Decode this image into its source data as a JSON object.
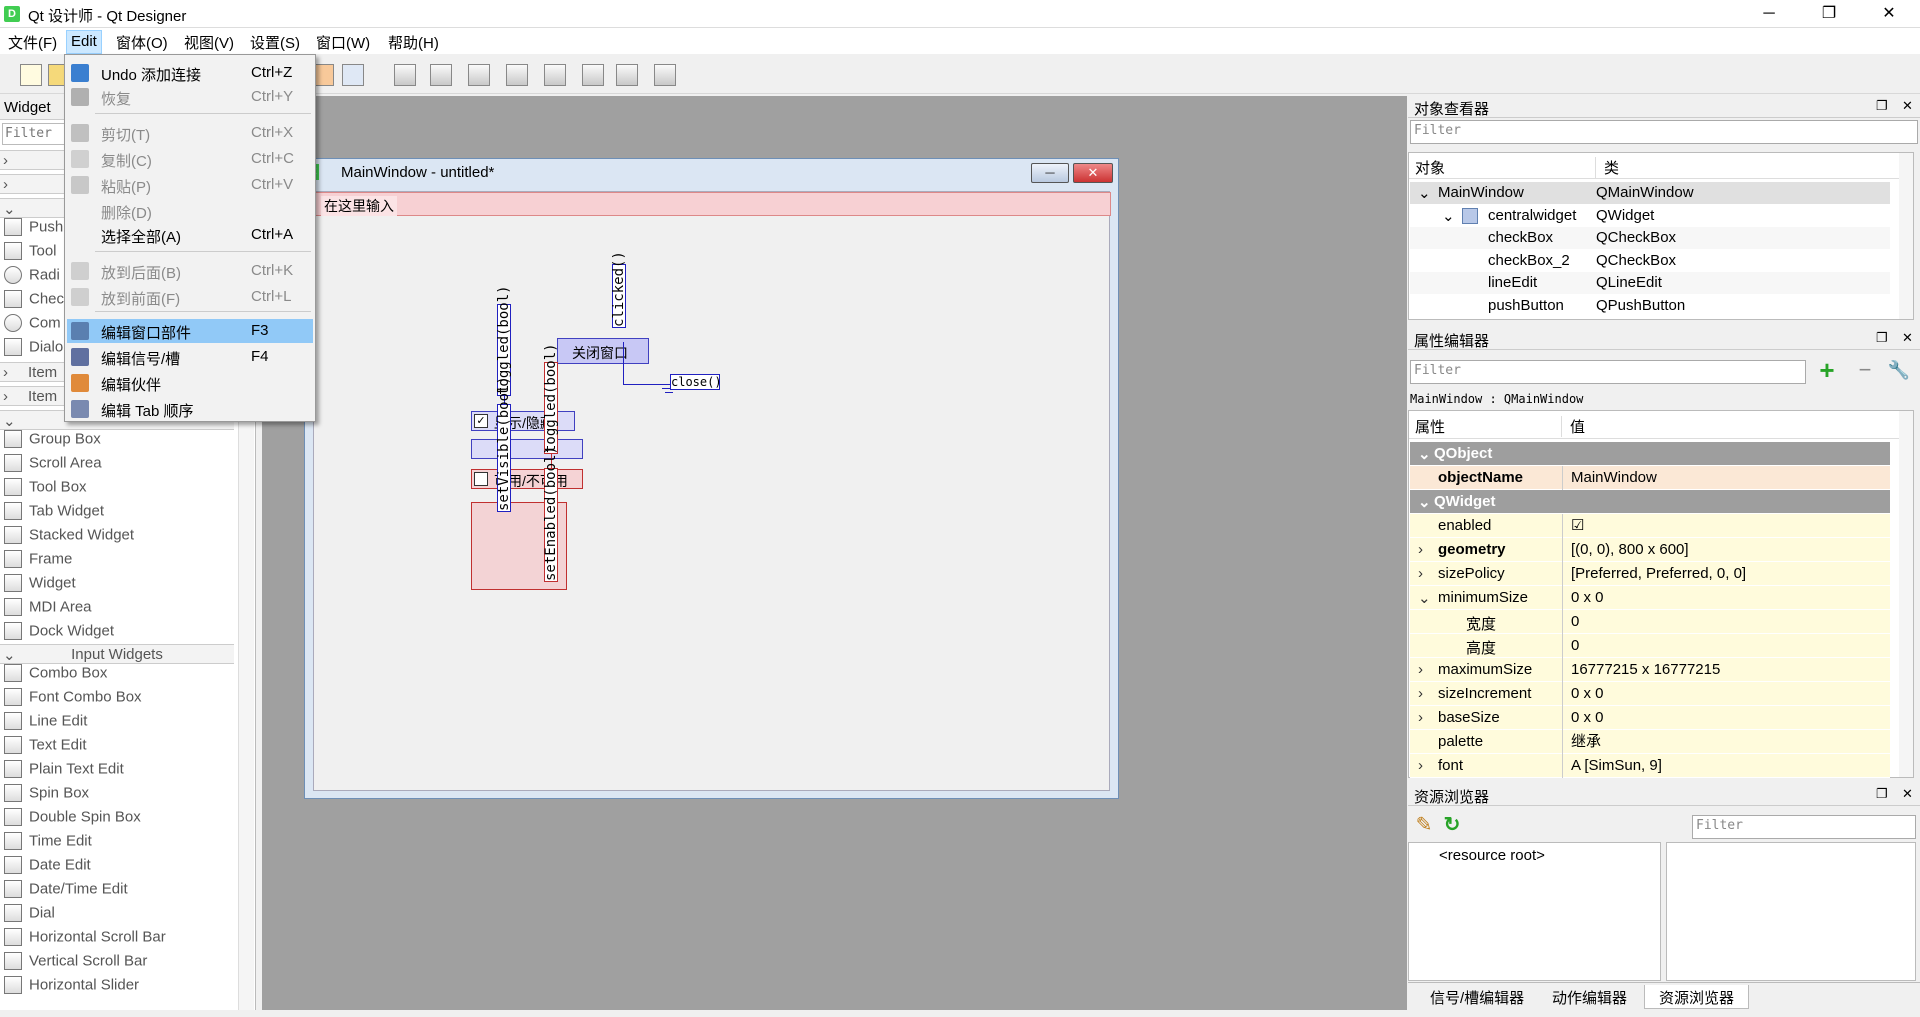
{
  "window": {
    "title": "Qt 设计师 - Qt Designer",
    "app_icon": "D",
    "minimize": "─",
    "maximize": "❐",
    "close": "✕"
  },
  "menubar": [
    "文件(F)",
    "Edit",
    "窗体(O)",
    "视图(V)",
    "设置(S)",
    "窗口(W)",
    "帮助(H)"
  ],
  "edit_menu": [
    {
      "label": "Undo 添加连接",
      "shortcut": "Ctrl+Z",
      "disabled": false,
      "icon": "undo-icon"
    },
    {
      "label": "恢复",
      "shortcut": "Ctrl+Y",
      "disabled": true,
      "icon": "redo-icon"
    },
    {
      "label": "剪切(T)",
      "shortcut": "Ctrl+X",
      "disabled": true,
      "icon": "scissors-icon"
    },
    {
      "label": "复制(C)",
      "shortcut": "Ctrl+C",
      "disabled": true,
      "icon": "copy-icon"
    },
    {
      "label": "粘贴(P)",
      "shortcut": "Ctrl+V",
      "disabled": true,
      "icon": "paste-icon"
    },
    {
      "label": "删除(D)",
      "shortcut": "",
      "disabled": true,
      "icon": ""
    },
    {
      "label": "选择全部(A)",
      "shortcut": "Ctrl+A",
      "disabled": false,
      "icon": ""
    },
    {
      "label": "放到后面(B)",
      "shortcut": "Ctrl+K",
      "disabled": true,
      "icon": "send-back-icon"
    },
    {
      "label": "放到前面(F)",
      "shortcut": "Ctrl+L",
      "disabled": true,
      "icon": "bring-front-icon"
    },
    {
      "label": "编辑窗口部件",
      "shortcut": "F3",
      "disabled": false,
      "icon": "edit-widgets-icon",
      "highlighted": true
    },
    {
      "label": "编辑信号/槽",
      "shortcut": "F4",
      "disabled": false,
      "icon": "edit-signals-icon"
    },
    {
      "label": "编辑伙伴",
      "shortcut": "",
      "disabled": false,
      "icon": "edit-buddies-icon"
    },
    {
      "label": "编辑 Tab 顺序",
      "shortcut": "",
      "disabled": false,
      "icon": "edit-tab-order-icon"
    }
  ],
  "widget_box": {
    "title": "Widget",
    "filter_placeholder": "Filter",
    "partial_items": [
      "Push",
      "Tool",
      "Radi",
      "Chec",
      "Com",
      "Dialo"
    ],
    "partial_cats": [
      "Item",
      "Item"
    ],
    "containers": [
      "Group Box",
      "Scroll Area",
      "Tool Box",
      "Tab Widget",
      "Stacked Widget",
      "Frame",
      "Widget",
      "MDI Area",
      "Dock Widget"
    ],
    "input_cat": "Input Widgets",
    "inputs": [
      "Combo Box",
      "Font Combo Box",
      "Line Edit",
      "Text Edit",
      "Plain Text Edit",
      "Spin Box",
      "Double Spin Box",
      "Time Edit",
      "Date Edit",
      "Date/Time Edit",
      "Dial",
      "Horizontal Scroll Bar",
      "Vertical Scroll Bar",
      "Horizontal Slider"
    ]
  },
  "form": {
    "title": "MainWindow - untitled*",
    "menu_placeholder": "在这里输入",
    "button_text": "关闭窗口",
    "checkbox1": "显示/隐藏",
    "checkbox2": "可用/不可用",
    "signal_clicked": "clicked()",
    "slot_close": "close()",
    "signal_toggled1": "toggled(bool)",
    "slot_setvisible": "setVisible(bool)",
    "signal_toggled2": "toggled(bool)",
    "slot_setenabled": "setEnabled(bool)"
  },
  "object_inspector": {
    "title": "对象查看器",
    "filter_placeholder": "Filter",
    "col_object": "对象",
    "col_class": "类",
    "rows": [
      {
        "name": "MainWindow",
        "cls": "QMainWindow"
      },
      {
        "name": "centralwidget",
        "cls": "QWidget"
      },
      {
        "name": "checkBox",
        "cls": "QCheckBox"
      },
      {
        "name": "checkBox_2",
        "cls": "QCheckBox"
      },
      {
        "name": "lineEdit",
        "cls": "QLineEdit"
      },
      {
        "name": "pushButton",
        "cls": "QPushButton"
      }
    ]
  },
  "property_editor": {
    "title": "属性编辑器",
    "filter_placeholder": "Filter",
    "context": "MainWindow : QMainWindow",
    "col_prop": "属性",
    "col_value": "值",
    "rows": [
      {
        "name": "QObject",
        "value": "",
        "kind": "group"
      },
      {
        "name": "objectName",
        "value": "MainWindow",
        "kind": "obj"
      },
      {
        "name": "QWidget",
        "value": "",
        "kind": "group"
      },
      {
        "name": "enabled",
        "value": "☑",
        "kind": "yellow"
      },
      {
        "name": "geometry",
        "value": "[(0, 0), 800 x 600]",
        "kind": "yellow",
        "bold": true
      },
      {
        "name": "sizePolicy",
        "value": "[Preferred, Preferred, 0, 0]",
        "kind": "yellow"
      },
      {
        "name": "minimumSize",
        "value": "0 x 0",
        "kind": "yellow"
      },
      {
        "name": "宽度",
        "value": "0",
        "kind": "yellow-sub"
      },
      {
        "name": "高度",
        "value": "0",
        "kind": "yellow-sub"
      },
      {
        "name": "maximumSize",
        "value": "16777215 x 16777215",
        "kind": "yellow"
      },
      {
        "name": "sizeIncrement",
        "value": "0 x 0",
        "kind": "yellow"
      },
      {
        "name": "baseSize",
        "value": "0 x 0",
        "kind": "yellow"
      },
      {
        "name": "palette",
        "value": "继承",
        "kind": "yellow"
      },
      {
        "name": "font",
        "value": "A  [SimSun, 9]",
        "kind": "yellow"
      }
    ]
  },
  "resource_browser": {
    "title": "资源浏览器",
    "filter_placeholder": "Filter",
    "root": "<resource root>"
  },
  "bottom_tabs": [
    "信号/槽编辑器",
    "动作编辑器",
    "资源浏览器"
  ]
}
